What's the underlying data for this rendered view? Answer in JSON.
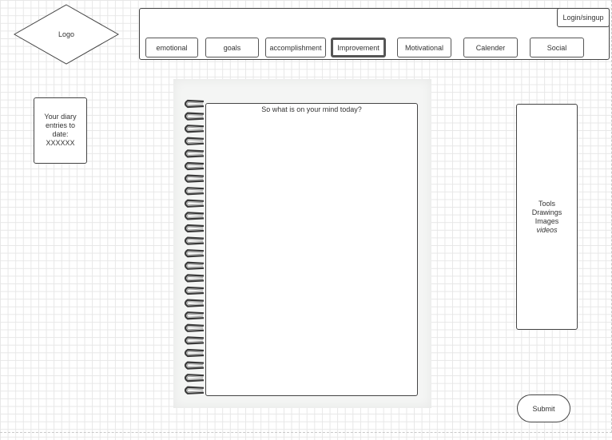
{
  "logo": {
    "label": "Logo"
  },
  "header": {
    "login_label": "Login/singup",
    "tabs": [
      {
        "label": "emotional",
        "active": false
      },
      {
        "label": "goals",
        "active": false
      },
      {
        "label": "accomplishment",
        "active": false
      },
      {
        "label": "Improvement",
        "active": true
      },
      {
        "label": "Motivational",
        "active": false
      },
      {
        "label": "Calender",
        "active": false
      },
      {
        "label": "Social",
        "active": false
      }
    ]
  },
  "sidebar": {
    "entries_lines": [
      "Your diary",
      "entries to",
      "date:",
      "XXXXXX"
    ]
  },
  "notebook": {
    "prompt": "So what is on your mind today?"
  },
  "tools": {
    "items": [
      "Tools",
      "Drawings",
      "Images",
      "videos"
    ]
  },
  "submit": {
    "label": "Submit"
  },
  "icons": {
    "spiral": "spiral-binding-icon",
    "logo_shape": "diamond-icon"
  }
}
